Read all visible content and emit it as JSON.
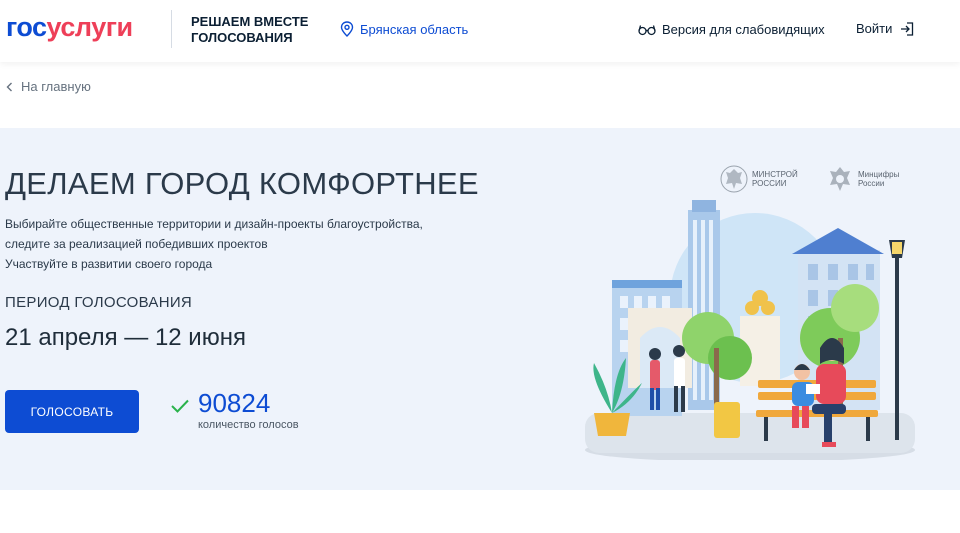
{
  "header": {
    "logo_part1": "гос",
    "logo_part2": "услуги",
    "tagline_line1": "РЕШАЕМ ВМЕСТЕ",
    "tagline_line2": "ГОЛОСОВАНИЯ",
    "region": "Брянская область",
    "vision_mode": "Версия для слабовидящих",
    "login": "Войти"
  },
  "breadcrumb": {
    "back_label": "На главную"
  },
  "hero": {
    "title": "ДЕЛАЕМ ГОРОД КОМФОРТНЕЕ",
    "desc_line1": "Выбирайте общественные территории и дизайн-проекты благоустройства,",
    "desc_line2": "следите за реализацией победивших проектов",
    "desc_line3": "Участвуйте в развитии своего города",
    "period_label": "ПЕРИОД ГОЛОСОВАНИЯ",
    "period_dates": "21 апреля — 12 июня",
    "vote_button": "ГОЛОСОВАТЬ",
    "vote_count": "90824",
    "vote_count_label": "количество голосов",
    "ministry1_line1": "МИНСТРОЙ",
    "ministry1_line2": "РОССИИ",
    "ministry2_line1": "Минцифры",
    "ministry2_line2": "России"
  },
  "colors": {
    "brand_blue": "#0d4cd3",
    "brand_red": "#ee3f58",
    "hero_bg": "#eef3fb",
    "check_green": "#2ab24b"
  },
  "icons": [
    "location-pin-icon",
    "glasses-icon",
    "login-arrow-icon",
    "chevron-left-icon",
    "check-icon",
    "emblem-icon"
  ]
}
